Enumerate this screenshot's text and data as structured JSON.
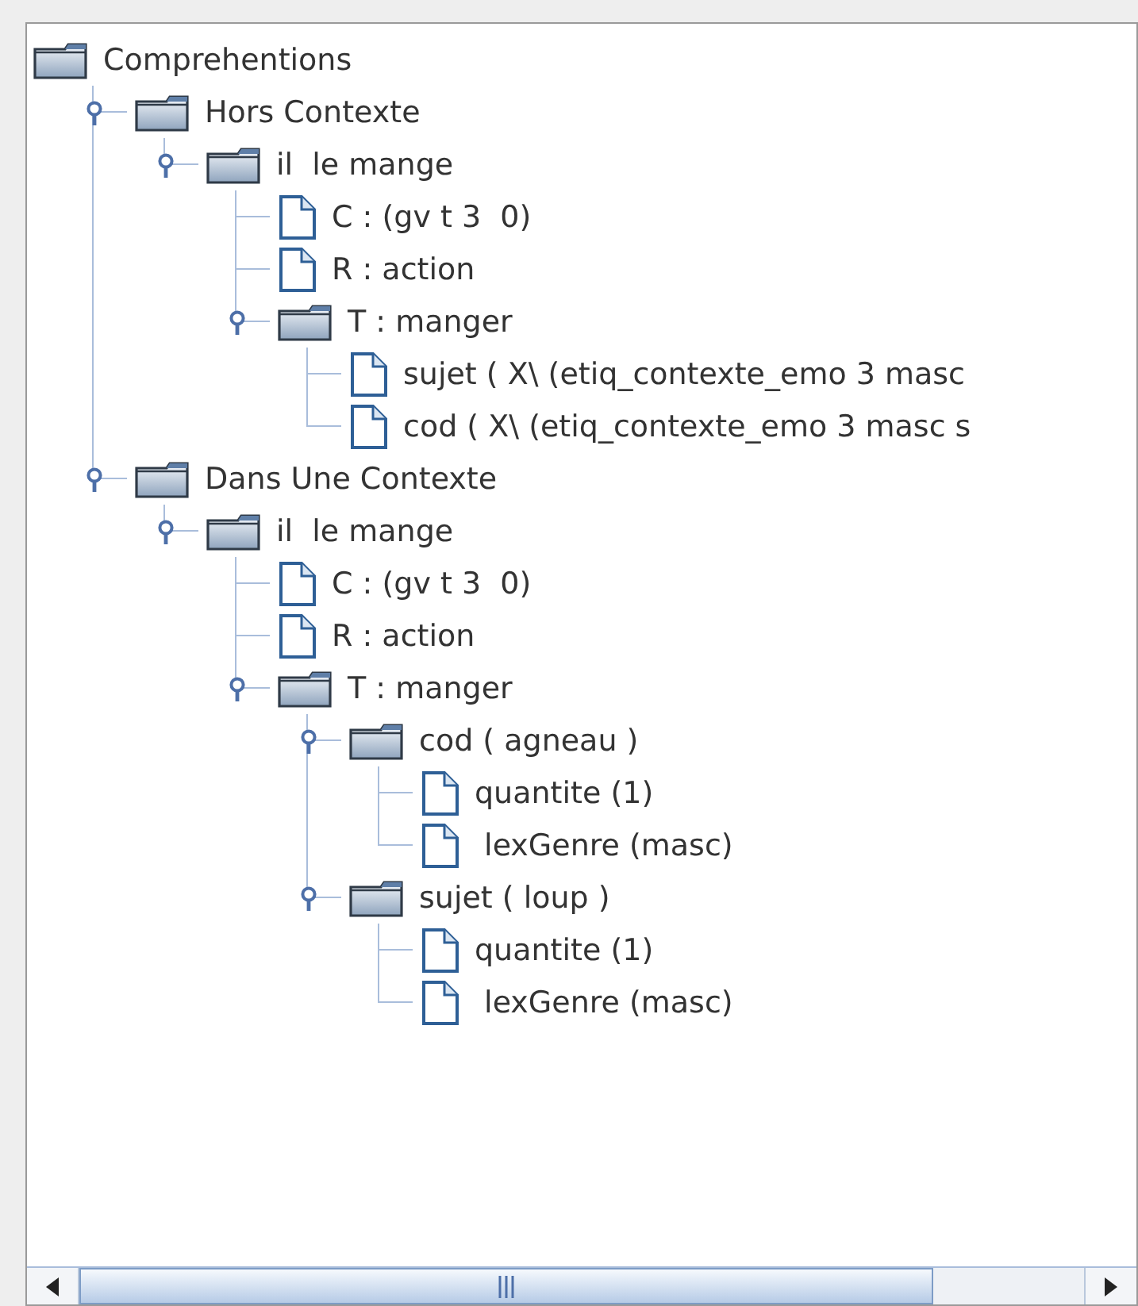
{
  "tree": {
    "label": "Comprehentions",
    "kind": "folder",
    "children": [
      {
        "label": "Hors Contexte",
        "kind": "folder",
        "expanded": true,
        "children": [
          {
            "label": "il  le mange",
            "kind": "folder",
            "expanded": true,
            "children": [
              {
                "label": "C : (gv t 3  0)",
                "kind": "leaf"
              },
              {
                "label": "R : action",
                "kind": "leaf"
              },
              {
                "label": "T : manger",
                "kind": "folder",
                "expanded": true,
                "children": [
                  {
                    "label": "sujet ( X\\ (etiq_contexte_emo 3 masc",
                    "kind": "leaf"
                  },
                  {
                    "label": "cod ( X\\ (etiq_contexte_emo 3 masc s",
                    "kind": "leaf"
                  }
                ]
              }
            ]
          }
        ]
      },
      {
        "label": "Dans Une Contexte",
        "kind": "folder",
        "expanded": true,
        "children": [
          {
            "label": "il  le mange",
            "kind": "folder",
            "expanded": true,
            "children": [
              {
                "label": "C : (gv t 3  0)",
                "kind": "leaf"
              },
              {
                "label": "R : action",
                "kind": "leaf"
              },
              {
                "label": "T : manger",
                "kind": "folder",
                "expanded": true,
                "children": [
                  {
                    "label": "cod ( agneau )",
                    "kind": "folder",
                    "expanded": true,
                    "children": [
                      {
                        "label": "quantite (1)",
                        "kind": "leaf"
                      },
                      {
                        "label": " lexGenre (masc)",
                        "kind": "leaf"
                      }
                    ]
                  },
                  {
                    "label": "sujet ( loup )",
                    "kind": "folder",
                    "expanded": true,
                    "children": [
                      {
                        "label": "quantite (1)",
                        "kind": "leaf"
                      },
                      {
                        "label": " lexGenre (masc)",
                        "kind": "leaf"
                      }
                    ]
                  }
                ]
              }
            ]
          }
        ]
      }
    ]
  }
}
